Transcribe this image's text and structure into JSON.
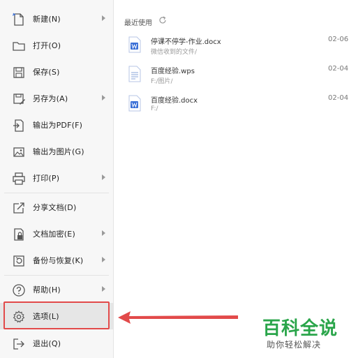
{
  "menu": {
    "items": [
      {
        "label": "新建(N)",
        "icon": "new-doc-icon",
        "has_submenu": true
      },
      {
        "label": "打开(O)",
        "icon": "folder-icon",
        "has_submenu": false
      },
      {
        "label": "保存(S)",
        "icon": "save-icon",
        "has_submenu": false
      },
      {
        "label": "另存为(A)",
        "icon": "save-as-icon",
        "has_submenu": true
      },
      {
        "label": "输出为PDF(F)",
        "icon": "pdf-export-icon",
        "has_submenu": false
      },
      {
        "label": "输出为图片(G)",
        "icon": "image-export-icon",
        "has_submenu": false
      },
      {
        "label": "打印(P)",
        "icon": "printer-icon",
        "has_submenu": true
      },
      {
        "label": "分享文档(D)",
        "icon": "share-icon",
        "has_submenu": false
      },
      {
        "label": "文档加密(E)",
        "icon": "lock-icon",
        "has_submenu": true
      },
      {
        "label": "备份与恢复(K)",
        "icon": "backup-icon",
        "has_submenu": true
      },
      {
        "label": "帮助(H)",
        "icon": "help-icon",
        "has_submenu": true
      },
      {
        "label": "选项(L)",
        "icon": "gear-icon",
        "has_submenu": false
      },
      {
        "label": "退出(Q)",
        "icon": "exit-icon",
        "has_submenu": false
      }
    ]
  },
  "recent": {
    "title": "最近使用",
    "files": [
      {
        "name": "停课不停学-作业.docx",
        "path": "微信收到的文件/",
        "date": "02-06",
        "type": "docx"
      },
      {
        "name": "百度经验.wps",
        "path": "F:/图片/",
        "date": "02-04",
        "type": "wps"
      },
      {
        "name": "百度经验.docx",
        "path": "F:/",
        "date": "02-04",
        "type": "docx"
      }
    ]
  },
  "watermark": {
    "title": "百科全说",
    "subtitle": "助你轻松解决"
  },
  "colors": {
    "highlight": "#e24a4a",
    "doc_blue": "#3a6fd6",
    "watermark_green": "#2aa54a"
  }
}
